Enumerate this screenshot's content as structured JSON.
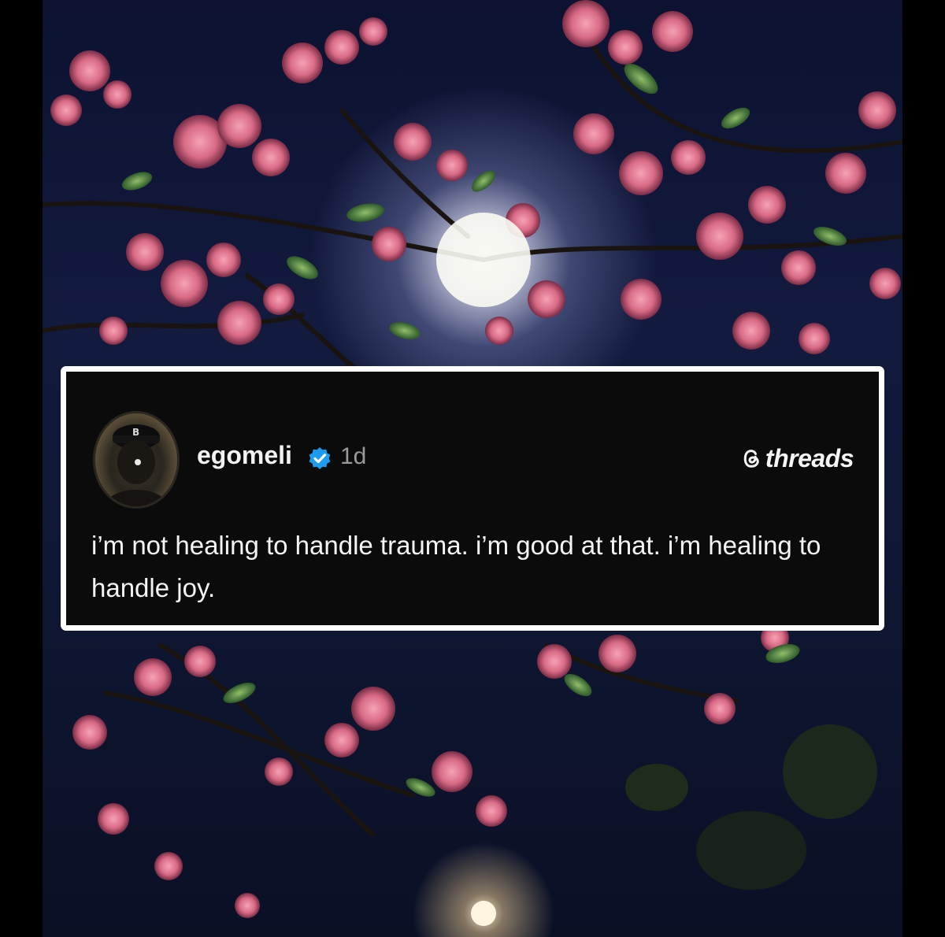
{
  "post": {
    "username": "egomeli",
    "verified": true,
    "timestamp": "1d",
    "text": "i’m not healing to handle trauma. i’m good at that. i’m healing to handle joy."
  },
  "brand": {
    "name": "threads",
    "icon": "threads-logo-icon"
  },
  "colors": {
    "card_background": "#0b0b0b",
    "card_border": "#ffffff",
    "verified_badge": "#1d9bf0",
    "timestamp": "#9a9a9a"
  }
}
